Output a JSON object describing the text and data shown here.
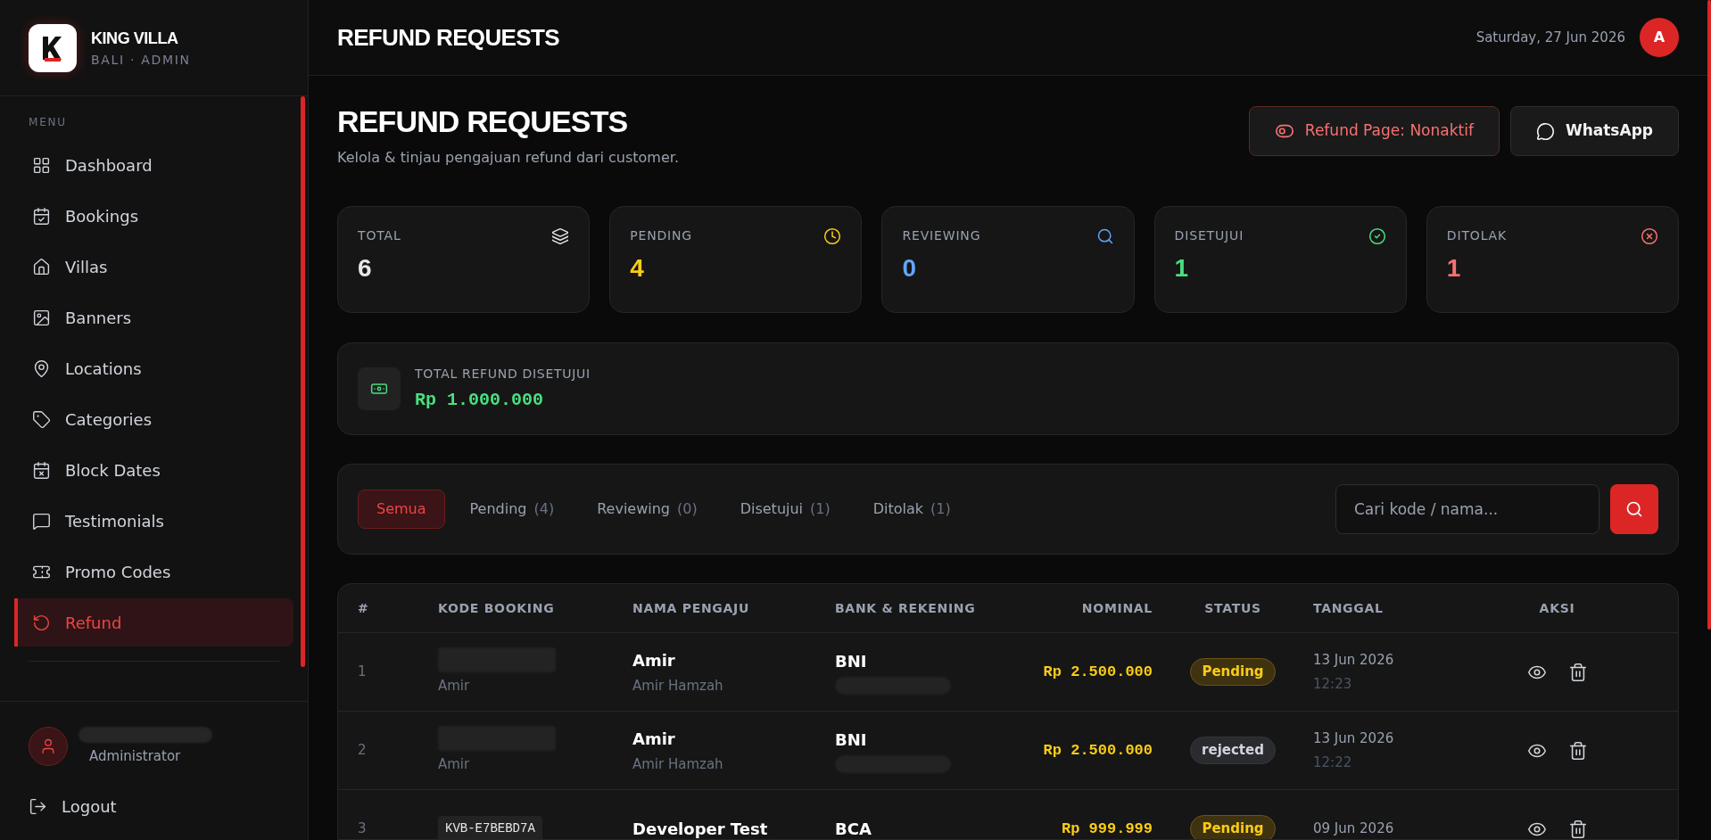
{
  "brand": {
    "name": "KING VILLA",
    "subtitle": "BALI · ADMIN"
  },
  "sidebar": {
    "section_label": "MENU",
    "items": [
      {
        "label": "Dashboard",
        "kind": "dashboard",
        "selected": false
      },
      {
        "label": "Bookings",
        "kind": "bookings",
        "selected": false
      },
      {
        "label": "Villas",
        "kind": "villas",
        "selected": false
      },
      {
        "label": "Banners",
        "kind": "banners",
        "selected": false
      },
      {
        "label": "Locations",
        "kind": "locations",
        "selected": false
      },
      {
        "label": "Categories",
        "kind": "categories",
        "selected": false
      },
      {
        "label": "Block Dates",
        "kind": "blockdates",
        "selected": false
      },
      {
        "label": "Testimonials",
        "kind": "testimonials",
        "selected": false
      },
      {
        "label": "Promo Codes",
        "kind": "promo",
        "selected": false
      },
      {
        "label": "Refund",
        "kind": "refund",
        "selected": true
      }
    ],
    "user": {
      "role": "Administrator"
    },
    "logout": "Logout"
  },
  "header": {
    "title": "REFUND REQUESTS",
    "date": "Saturday, 27 Jun 2026",
    "avatar": "A"
  },
  "page": {
    "title": "REFUND REQUESTS",
    "subtitle": "Kelola & tinjau pengajuan refund dari customer.",
    "buttons": [
      {
        "label": "Refund Page: Nonaktif",
        "kind": "toggle"
      },
      {
        "label": "WhatsApp",
        "kind": "whatsapp"
      }
    ]
  },
  "stats": [
    {
      "label": "TOTAL",
      "value": "6",
      "kind": "total"
    },
    {
      "label": "PENDING",
      "value": "4",
      "kind": "pending"
    },
    {
      "label": "REVIEWING",
      "value": "0",
      "kind": "reviewing"
    },
    {
      "label": "DISETUJUI",
      "value": "1",
      "kind": "approved"
    },
    {
      "label": "DITOLAK",
      "value": "1",
      "kind": "rejected"
    }
  ],
  "total_refund": {
    "label": "TOTAL REFUND DISETUJUI",
    "value": "Rp 1.000.000"
  },
  "filters": {
    "tabs": [
      {
        "label": "Semua",
        "selected": true
      },
      {
        "label": "Pending",
        "count": "(4)",
        "selected": false
      },
      {
        "label": "Reviewing",
        "count": "(0)",
        "selected": false
      },
      {
        "label": "Disetujui",
        "count": "(1)",
        "selected": false
      },
      {
        "label": "Ditolak",
        "count": "(1)",
        "selected": false
      }
    ],
    "search": {
      "placeholder": "Cari kode / nama..."
    }
  },
  "table": {
    "columns": [
      "#",
      "KODE BOOKING",
      "NAMA PENGAJU",
      "BANK & REKENING",
      "NOMINAL",
      "STATUS",
      "TANGGAL",
      "AKSI"
    ],
    "rows": [
      {
        "no": "1",
        "code_sub": "Amir",
        "name": "Amir",
        "name_sub": "Amir Hamzah",
        "bank": "BNI",
        "amount": "Rp 2.500.000",
        "status": {
          "text": "Pending",
          "kind": "pending"
        },
        "date": "13 Jun 2026",
        "time": "12:23"
      },
      {
        "no": "2",
        "code_sub": "Amir",
        "name": "Amir",
        "name_sub": "Amir Hamzah",
        "bank": "BNI",
        "amount": "Rp 2.500.000",
        "status": {
          "text": "rejected",
          "kind": "rejected"
        },
        "date": "13 Jun 2026",
        "time": "12:22"
      },
      {
        "no": "3",
        "code": "KVB-E7BEBD7A",
        "name": "Developer Test",
        "bank": "BCA",
        "amount": "Rp 999.999",
        "status": {
          "text": "Pending",
          "kind": "pending"
        },
        "date": "09 Jun 2026"
      }
    ]
  }
}
